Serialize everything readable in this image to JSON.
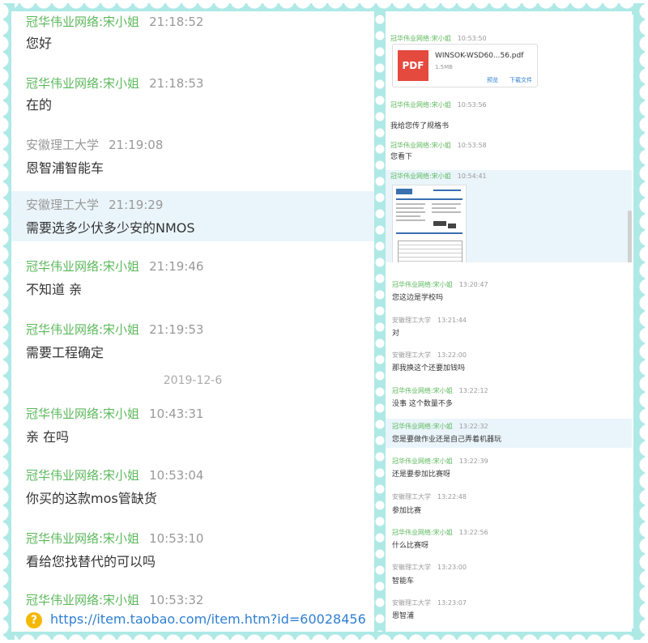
{
  "left_panel": {
    "messages": [
      {
        "name": "冠华伟业网络:宋小姐",
        "time": "21:18:52",
        "text": "您好",
        "role": "agent"
      },
      {
        "name": "冠华伟业网络:宋小姐",
        "time": "21:18:53",
        "text": "在的",
        "role": "agent"
      },
      {
        "name": "安徽理工大学",
        "time": "21:19:08",
        "text": "恩智浦智能车",
        "role": "customer"
      },
      {
        "name": "安徽理工大学",
        "time": "21:19:29",
        "text": "需要选多少伏多少安的NMOS",
        "role": "customer"
      },
      {
        "name": "冠华伟业网络:宋小姐",
        "time": "21:19:46",
        "text": "不知道 亲",
        "role": "agent"
      },
      {
        "name": "冠华伟业网络:宋小姐",
        "time": "21:19:53",
        "text": "需要工程确定",
        "role": "agent"
      },
      {
        "name": "冠华伟业网络:宋小姐",
        "time": "10:43:31",
        "text": "亲 在吗",
        "role": "agent"
      },
      {
        "name": "冠华伟业网络:宋小姐",
        "time": "10:53:04",
        "text": "你买的这款mos管缺货",
        "role": "agent"
      },
      {
        "name": "冠华伟业网络:宋小姐",
        "time": "10:53:10",
        "text": "看给您找替代的可以吗",
        "role": "agent"
      },
      {
        "name": "冠华伟业网络:宋小姐",
        "time": "10:53:32",
        "text": "",
        "role": "agent"
      }
    ],
    "date_separator": "2019-12-6",
    "link": "https://item.taobao.com/item.htm?id=60028456"
  },
  "right_top": {
    "messages": [
      {
        "name": "冠华伟业网络:宋小姐",
        "time": "10:53:50",
        "text": ""
      },
      {
        "name": "冠华伟业网络:宋小姐",
        "time": "10:53:56",
        "text": "我给您传了规格书"
      },
      {
        "name": "冠华伟业网络:宋小姐",
        "time": "10:53:58",
        "text": "您看下"
      },
      {
        "name": "冠华伟业网络:宋小姐",
        "time": "10:54:41",
        "text": ""
      }
    ],
    "pdf": {
      "badge": "PDF",
      "name": "WINSOK-WSD60...56.pdf",
      "size": "1.5MB",
      "preview": "预览",
      "download": "下载文件"
    }
  },
  "right_bottom": {
    "messages": [
      {
        "name": "冠华伟业网络:宋小姐",
        "time": "13:20:47",
        "text": "您这边是学校吗",
        "role": "agent"
      },
      {
        "name": "安徽理工大学",
        "time": "13:21:44",
        "text": "对",
        "role": "customer"
      },
      {
        "name": "安徽理工大学",
        "time": "13:22:00",
        "text": "那我换这个还要加钱吗",
        "role": "customer"
      },
      {
        "name": "冠华伟业网络:宋小姐",
        "time": "13:22:12",
        "text": "没事 这个数量不多",
        "role": "agent"
      },
      {
        "name": "冠华伟业网络:宋小姐",
        "time": "13:22:32",
        "text": "您是要做作业还是自己弄着机器玩",
        "role": "agent"
      },
      {
        "name": "冠华伟业网络:宋小姐",
        "time": "13:22:39",
        "text": "还是要参加比赛呀",
        "role": "agent"
      },
      {
        "name": "安徽理工大学",
        "time": "13:22:48",
        "text": "参加比赛",
        "role": "customer"
      },
      {
        "name": "冠华伟业网络:宋小姐",
        "time": "13:22:56",
        "text": "什么比赛呀",
        "role": "agent"
      },
      {
        "name": "安徽理工大学",
        "time": "13:23:00",
        "text": "智能车",
        "role": "customer"
      },
      {
        "name": "安徽理工大学",
        "time": "13:23:07",
        "text": "恩智浦",
        "role": "customer"
      }
    ]
  },
  "colors": {
    "agent": "#5cb85c",
    "customer": "#999999",
    "frame": "#aee9e6",
    "highlight": "#eaf5fb",
    "link": "#2f7fd1"
  },
  "icons": {
    "link_icon": "question-circle-icon",
    "file_icon": "pdf-file-icon"
  }
}
